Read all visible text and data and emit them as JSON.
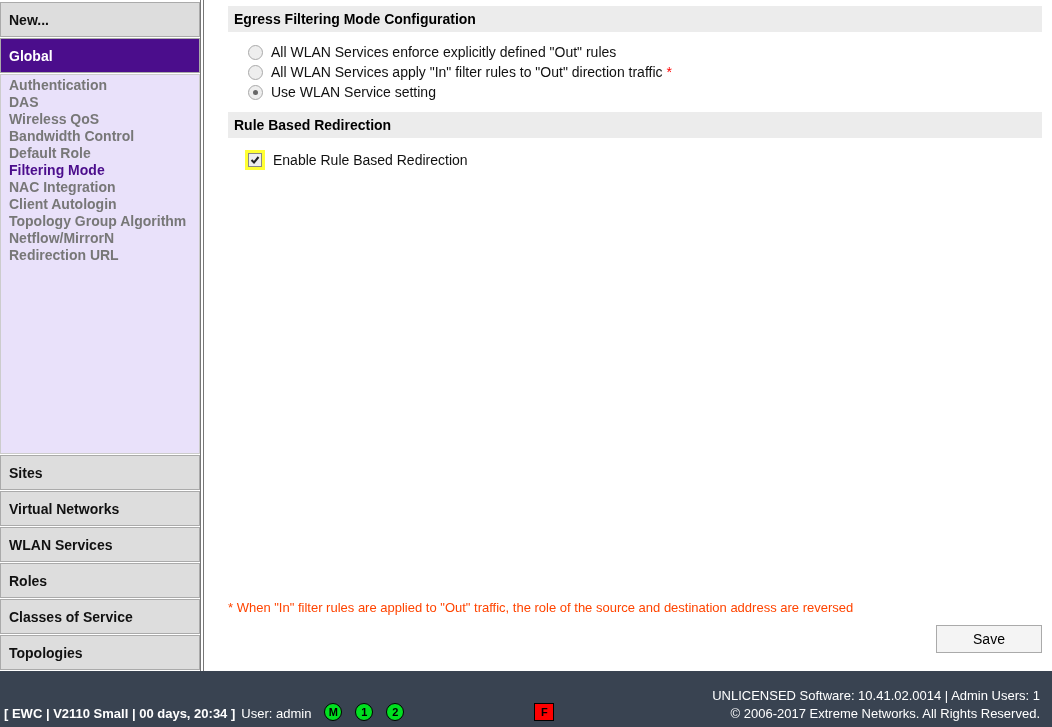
{
  "sidebar": {
    "new_button": "New...",
    "sections": [
      {
        "label": "Global",
        "selected": true,
        "children": [
          {
            "label": "Authentication",
            "selected": false
          },
          {
            "label": "DAS",
            "selected": false
          },
          {
            "label": "Wireless QoS",
            "selected": false
          },
          {
            "label": "Bandwidth Control",
            "selected": false
          },
          {
            "label": "Default Role",
            "selected": false
          },
          {
            "label": "Filtering Mode",
            "selected": true
          },
          {
            "label": "NAC Integration",
            "selected": false
          },
          {
            "label": "Client Autologin",
            "selected": false
          },
          {
            "label": "Topology Group Algorithm",
            "selected": false
          },
          {
            "label": "Netflow/MirrorN",
            "selected": false
          },
          {
            "label": "Redirection URL",
            "selected": false
          }
        ]
      },
      {
        "label": "Sites",
        "selected": false
      },
      {
        "label": "Virtual Networks",
        "selected": false
      },
      {
        "label": "WLAN Services",
        "selected": false
      },
      {
        "label": "Roles",
        "selected": false
      },
      {
        "label": "Classes of Service",
        "selected": false
      },
      {
        "label": "Topologies",
        "selected": false
      }
    ]
  },
  "main": {
    "sections": [
      {
        "title": "Egress Filtering Mode Configuration",
        "kind": "radio",
        "options": [
          {
            "label": "All WLAN Services enforce explicitly defined \"Out\" rules",
            "selected": false
          },
          {
            "label": "All WLAN Services apply \"In\" filter rules to \"Out\" direction traffic",
            "selected": false,
            "note": "*"
          },
          {
            "label": "Use WLAN Service setting",
            "selected": true
          }
        ]
      },
      {
        "title": "Rule Based Redirection",
        "kind": "checkbox",
        "options": [
          {
            "label": "Enable Rule Based Redirection",
            "checked": true,
            "highlighted": true
          }
        ]
      }
    ],
    "footnote": "* When \"In\" filter rules are applied to \"Out\" traffic, the role of the source and destination address are reversed",
    "save_button": "Save"
  },
  "status_bar": {
    "session": "[ EWC | V2110 Small | 00 days, 20:34 ]",
    "user": "User: admin",
    "indicators": [
      {
        "label": "M",
        "color": "#00e020"
      },
      {
        "label": "1",
        "color": "#00e020"
      },
      {
        "label": "2",
        "color": "#00e020"
      }
    ],
    "alarm": {
      "label": "F",
      "color": "#ff0000"
    },
    "license": "UNLICENSED Software: 10.41.02.0014 | Admin Users: 1",
    "copyright": "© 2006-2017  Extreme Networks. All Rights Reserved."
  }
}
